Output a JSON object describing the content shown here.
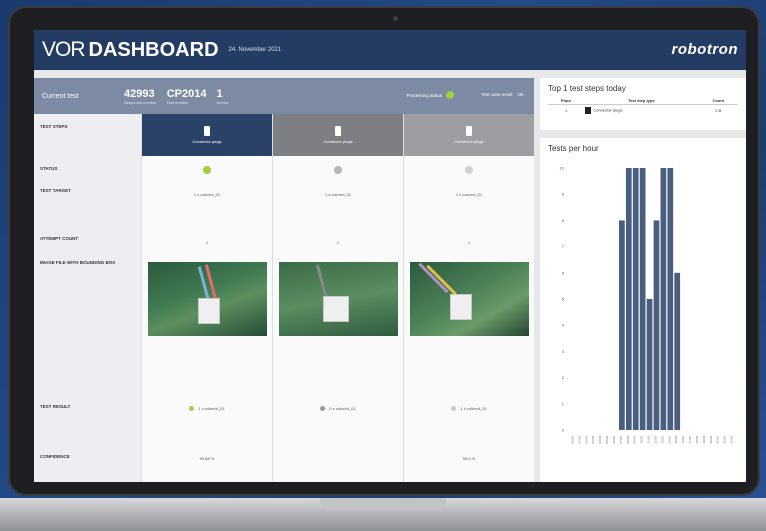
{
  "header": {
    "logo_vor": "VOR",
    "logo_dashboard": "DASHBOARD",
    "date": "24. November 2021",
    "brand": "robotron"
  },
  "current_test": {
    "label": "Current test",
    "sequence_number": "42993",
    "sequence_label": "Sequence number",
    "part_number": "CP2014",
    "part_label": "Part number",
    "device": "1",
    "device_label": "Device",
    "processing_status_label": "Processing status",
    "test_case_result_label": "Test case result",
    "test_case_result_value": "OK"
  },
  "row_labels": {
    "test_steps": "TEST STEPS",
    "status": "STATUS",
    "test_target": "TEST TARGET",
    "attempt_count": "ATTEMPT COUNT",
    "image": "IMAGE FILE WITH BOUNDING BOX",
    "test_result": "TEST RESULT",
    "confidence": "CONFIDENCE"
  },
  "steps": [
    {
      "name": "Connector plugs",
      "target": "1 x colored_01",
      "attempts": "1",
      "result": "1 x colored_01",
      "confidence": "99,88 %",
      "status_color": "#9fd03c"
    },
    {
      "name": "Connector plugs",
      "target": "1 x colored_01",
      "attempts": "1",
      "result": "0 x colored_01",
      "confidence": "",
      "status_color": "#b5b6b8"
    },
    {
      "name": "Connector plugs",
      "target": "1 x colored_01",
      "attempts": "1",
      "result": "1 x colored_01",
      "confidence": "99,6 %",
      "status_color": "#cfd0d2"
    }
  ],
  "top_steps": {
    "title": "Top 1 test steps today",
    "headers": [
      "Place",
      "Test step type",
      "Count"
    ],
    "rows": [
      [
        "1",
        "Connector plugs",
        "2 B"
      ]
    ]
  },
  "tests_per_hour": {
    "title": "Tests per hour"
  },
  "chart_data": {
    "type": "bar",
    "title": "Tests per hour",
    "ylim": [
      0,
      10
    ],
    "yticks": [
      "0",
      "1",
      "2",
      "3",
      "4",
      "5",
      "6",
      "7",
      "8",
      "9",
      "10"
    ],
    "categories": [
      "00:00",
      "01:00",
      "02:00",
      "03:00",
      "04:00",
      "05:00",
      "06:00",
      "07:00",
      "08:00",
      "09:00",
      "10:00",
      "11:00",
      "12:00",
      "13:00",
      "14:00",
      "15:00",
      "16:00",
      "17:00",
      "18:00",
      "19:00",
      "20:00",
      "21:00",
      "22:00",
      "23:00"
    ],
    "values": [
      0,
      0,
      0,
      0,
      0,
      0,
      0,
      8,
      10,
      10,
      10,
      5,
      8,
      10,
      10,
      6,
      0,
      0,
      0,
      0,
      0,
      0,
      0,
      0
    ],
    "color": "#4a5e80"
  }
}
